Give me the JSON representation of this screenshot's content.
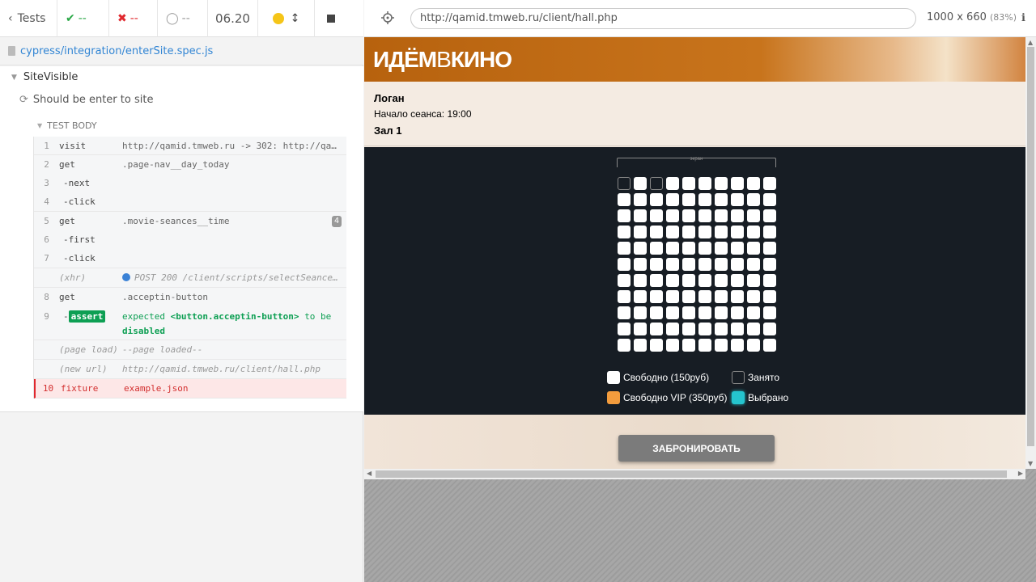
{
  "topbar": {
    "tests_label": "Tests",
    "passed": "--",
    "failed": "--",
    "pending": "--",
    "duration": "06.20"
  },
  "spec": {
    "file": "cypress/integration/enterSite.spec.js"
  },
  "suite": {
    "title": "SiteVisible"
  },
  "test": {
    "title": "Should be enter to site"
  },
  "test_body_label": "TEST BODY",
  "commands": [
    {
      "num": "1",
      "name": "visit",
      "message": "http://qamid.tmweb.ru -> 302: http://qam…"
    },
    {
      "num": "2",
      "name": "get",
      "message": ".page-nav__day_today"
    },
    {
      "num": "3",
      "name": "-next",
      "message": ""
    },
    {
      "num": "4",
      "name": "-click",
      "message": ""
    },
    {
      "num": "5",
      "name": "get",
      "message": ".movie-seances__time",
      "badge": "4"
    },
    {
      "num": "6",
      "name": "-first",
      "message": ""
    },
    {
      "num": "7",
      "name": "-click",
      "message": ""
    },
    {
      "num": "",
      "name": "(xhr)",
      "message": "POST 200 /client/scripts/selectSeance…"
    },
    {
      "num": "8",
      "name": "get",
      "message": ".acceptin-button"
    },
    {
      "num": "9",
      "name": "-",
      "assert_label": "assert",
      "message_parts": [
        "expected",
        "<button.acceptin-button>",
        "to be",
        "disabled"
      ]
    },
    {
      "num": "",
      "name": "(page load)",
      "message": "--page loaded--"
    },
    {
      "num": "",
      "name": "(new url)",
      "message": "http://qamid.tmweb.ru/client/hall.php"
    },
    {
      "num": "10",
      "name": "fixture",
      "message": "example.json"
    }
  ],
  "browser": {
    "url": "http://qamid.tmweb.ru/client/hall.php",
    "viewport": "1000 x 660",
    "zoom": "(83%)"
  },
  "app": {
    "logo_main": "ИДЁМ",
    "logo_v": "В",
    "logo_end": "КИНО",
    "movie_title": "Логан",
    "start_time": "Начало сеанса: 19:00",
    "hall": "Зал 1",
    "screen_label": "экран",
    "legend": {
      "free": "Свободно (150руб)",
      "taken": "Занято",
      "vip": "Свободно VIP (350руб)",
      "selected": "Выбрано"
    },
    "book_button": "ЗАБРОНИРОВАТЬ",
    "colors": {
      "free": "#ffffff",
      "taken": "#171d24",
      "vip": "#f39c3d",
      "selected": "#25c4ce"
    }
  }
}
